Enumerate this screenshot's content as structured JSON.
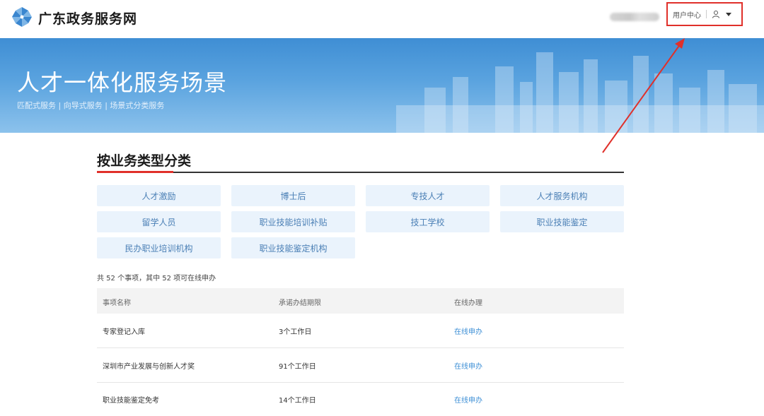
{
  "header": {
    "site_name": "广东政务服务网",
    "user_center_label": "用户中心",
    "highlight_color": "#e0302a"
  },
  "banner": {
    "title": "人才一体化服务场景",
    "subtitle": "匹配式服务 | 向导式服务 | 场景式分类服务"
  },
  "section": {
    "title": "按业务类型分类",
    "categories": [
      "人才激励",
      "博士后",
      "专技人才",
      "人才服务机构",
      "留学人员",
      "职业技能培训补贴",
      "技工学校",
      "职业技能鉴定",
      "民办职业培训机构",
      "职业技能鉴定机构"
    ],
    "summary": "共 52 个事项，其中 52 项可在线申办"
  },
  "table": {
    "headers": [
      "事项名称",
      "承诺办结期限",
      "在线办理"
    ],
    "rows": [
      {
        "name": "专家登记入库",
        "deadline": "3个工作日",
        "action": "在线申办"
      },
      {
        "name": "深圳市产业发展与创新人才奖",
        "deadline": "91个工作日",
        "action": "在线申办"
      },
      {
        "name": "职业技能鉴定免考",
        "deadline": "14个工作日",
        "action": "在线申办"
      }
    ]
  }
}
